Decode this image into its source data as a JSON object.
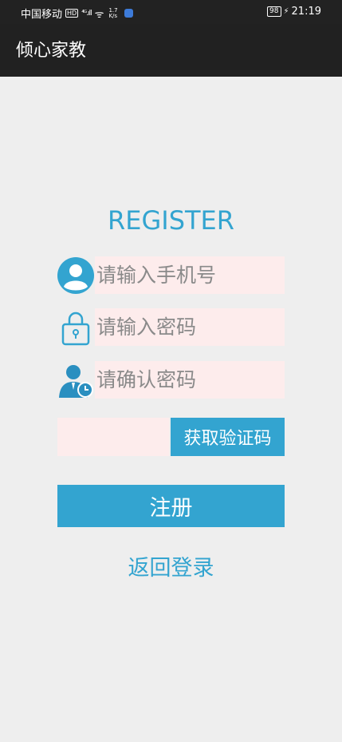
{
  "status_bar": {
    "carrier": "中国移动",
    "hd_badge": "HD",
    "network": "⁴ᴳ.ıll",
    "wifi": "ᯤ",
    "speed_value": "1.7",
    "speed_unit": "K/s",
    "battery": "98",
    "charging": "⚡",
    "time": "21:19"
  },
  "app_bar": {
    "title": "倾心家教"
  },
  "form": {
    "heading": "REGISTER",
    "phone_placeholder": "请输入手机号",
    "password_placeholder": "请输入密码",
    "confirm_placeholder": "请确认密码",
    "code_placeholder": "",
    "get_code_label": "获取验证码",
    "register_label": "注册",
    "back_to_login": "返回登录"
  },
  "icons": {
    "phone_field": "user-avatar-icon",
    "password_field": "lock-icon",
    "confirm_field": "user-clock-icon"
  },
  "colors": {
    "accent": "#33a4d0",
    "input_bg": "#fdecec",
    "app_bar": "#212121",
    "background": "#eeeeee"
  }
}
